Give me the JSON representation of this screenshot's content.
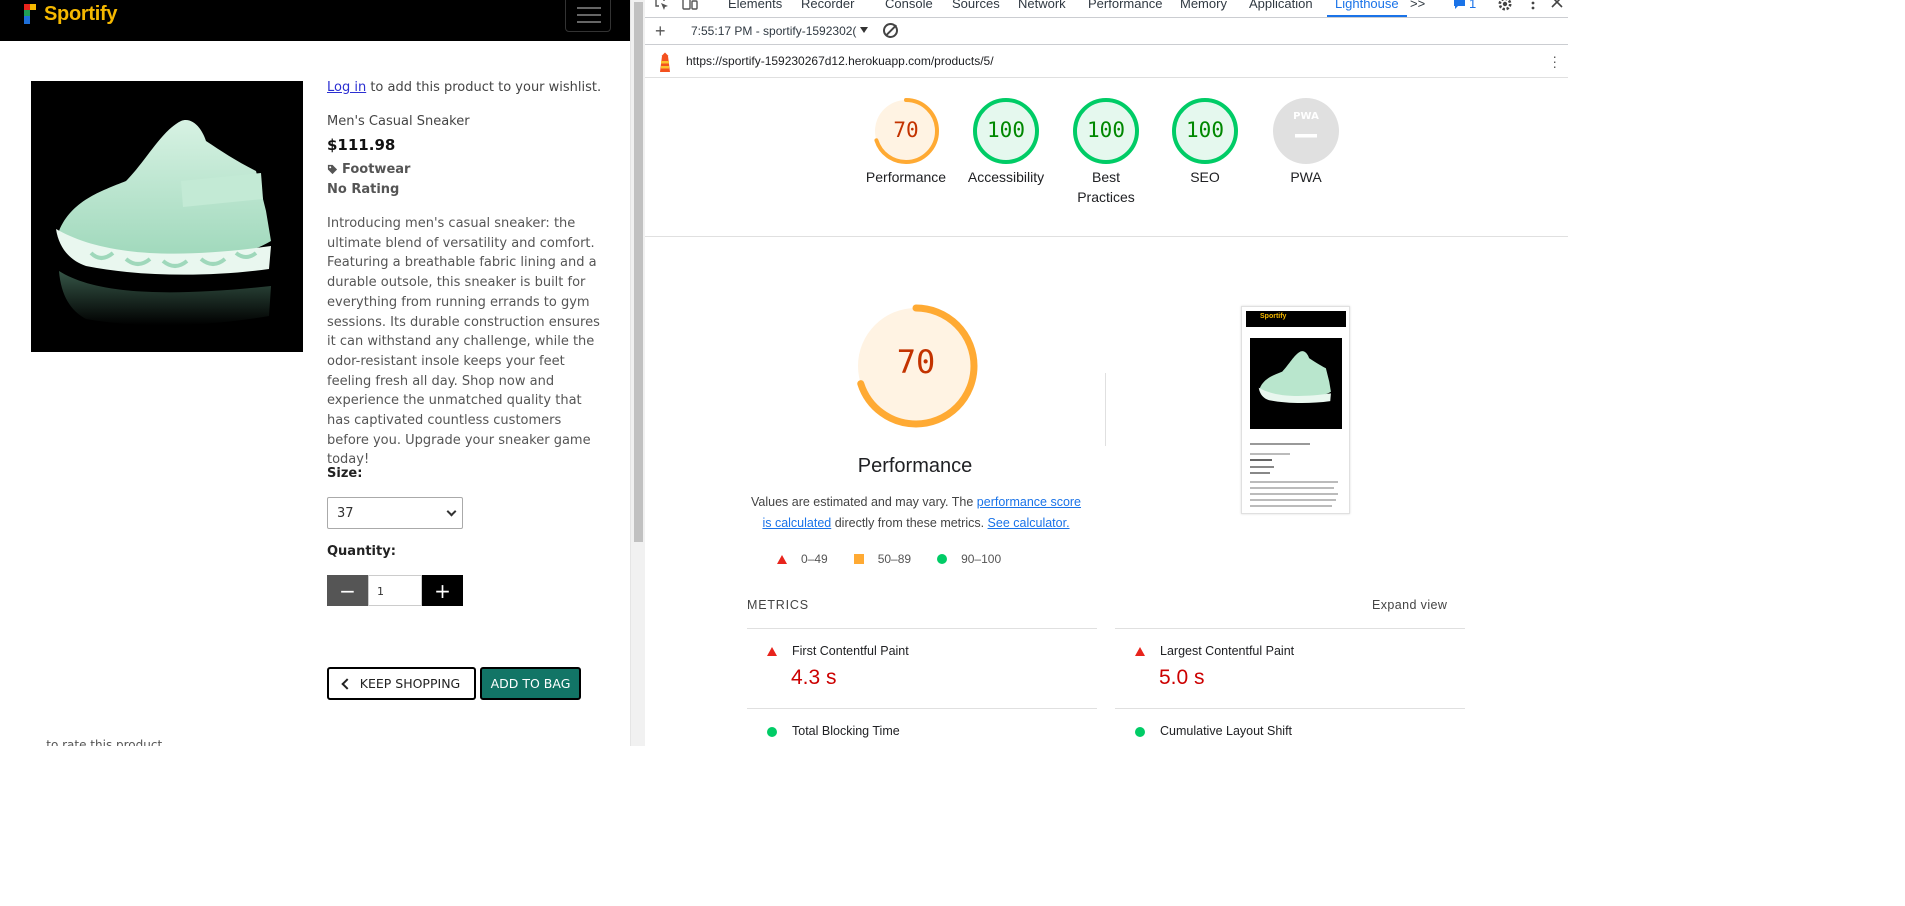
{
  "site": {
    "logo_text": "Sportify",
    "wishlist_link": "Log in",
    "wishlist_rest": " to add this product to your wishlist.",
    "product_name": "Men's Casual Sneaker",
    "price": "$111.98",
    "category": "Footwear",
    "rating": "No Rating",
    "description": "Introducing men's casual sneaker: the ultimate blend of versatility and comfort. Featuring a breathable fabric lining and a durable outsole, this sneaker is built for everything from running errands to gym sessions. Its durable construction ensures it can withstand any challenge, while the odor-resistant insole keeps your feet feeling fresh all day. Shop now and experience the unmatched quality that has captivated countless customers before you. Upgrade your sneaker game today!",
    "size_label": "Size:",
    "size_value": "37",
    "quantity_label": "Quantity:",
    "quantity_value": "1",
    "minus_symbol": "−",
    "plus_symbol": "+",
    "keep_shopping": "KEEP SHOPPING",
    "add_to_bag": "ADD TO BAG",
    "footer_cut": "... to rate this product."
  },
  "devtools": {
    "tabs": [
      "Elements",
      "Recorder",
      "Console",
      "Sources",
      "Network",
      "Performance",
      "Memory",
      "Application",
      "Lighthouse"
    ],
    "active_tab": "Lighthouse",
    "more_tabs": ">>",
    "issues_count": "1",
    "report_label": "7:55:17 PM - sportify-1592302(",
    "url": "https://sportify-159230267d12.herokuapp.com/products/5/",
    "gauges": [
      {
        "label": "Performance",
        "value": "70",
        "score": 70,
        "color": "#fa3"
      },
      {
        "label": "Accessibility",
        "value": "100",
        "score": 100,
        "color": "#0c6"
      },
      {
        "label": "Best Practices",
        "value": "100",
        "score": 100,
        "color": "#0c6"
      },
      {
        "label": "SEO",
        "value": "100",
        "score": 100,
        "color": "#0c6"
      },
      {
        "label": "PWA",
        "value": "PWA",
        "score": 0,
        "color": "#9e9e9e"
      }
    ],
    "perf": {
      "score": "70",
      "score_num": 70,
      "title": "Performance",
      "note_pre": "Values are estimated and may vary. The ",
      "note_link1": "performance score is calculated",
      "note_mid": " directly from these metrics. ",
      "note_link2": "See calculator.",
      "legend": [
        "0–49",
        "50–89",
        "90–100"
      ]
    },
    "thumbnail": {
      "logo_text": "Sportify"
    },
    "metrics_heading": "METRICS",
    "expand_view": "Expand view",
    "metrics": [
      {
        "name": "First Contentful Paint",
        "value": "4.3 s",
        "status": "fail"
      },
      {
        "name": "Largest Contentful Paint",
        "value": "5.0 s",
        "status": "fail"
      },
      {
        "name": "Total Blocking Time",
        "value": "",
        "status": "pass"
      },
      {
        "name": "Cumulative Layout Shift",
        "value": "",
        "status": "pass"
      }
    ],
    "colors": {
      "accent": "#1a73e8",
      "fail": "#e8241c",
      "average": "#fa3",
      "pass": "#0c6",
      "brand": "#f5b800",
      "add_to_bag": "#127566"
    }
  }
}
